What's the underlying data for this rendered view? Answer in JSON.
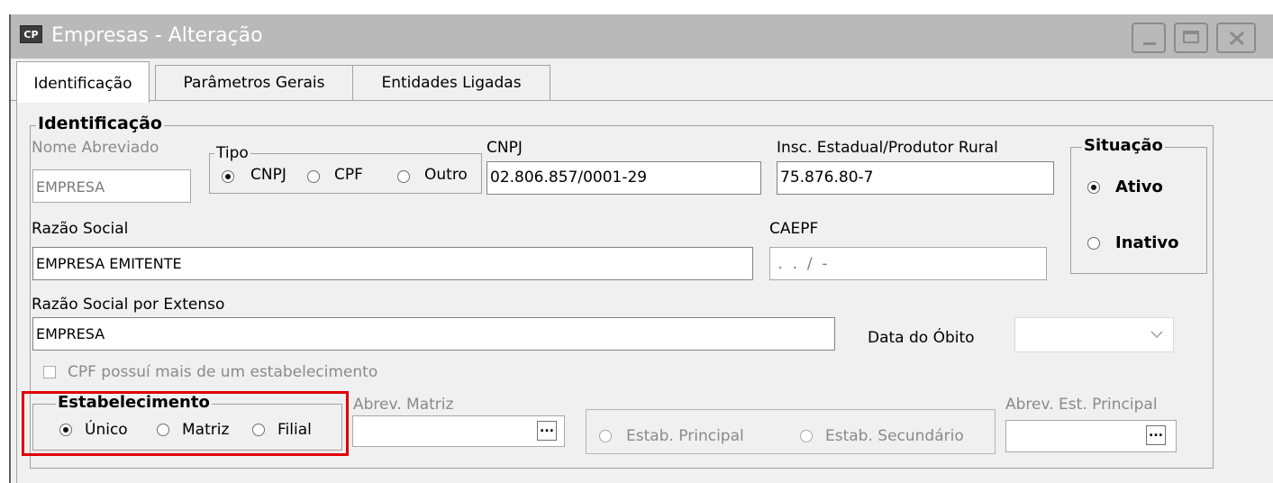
{
  "window": {
    "title": "Empresas - Alteração",
    "icon_label": "CP",
    "controls": [
      "minimize-icon",
      "maximize-icon",
      "close-icon"
    ]
  },
  "tabs": [
    {
      "label": "Identificação",
      "active": true
    },
    {
      "label": "Parâmetros Gerais",
      "active": false
    },
    {
      "label": "Entidades Ligadas",
      "active": false
    }
  ],
  "identificacao": {
    "group_label": "Identificação",
    "nome_abreviado": {
      "label": "Nome Abreviado",
      "value": "EMPRESA"
    },
    "tipo": {
      "label": "Tipo",
      "options": [
        "CNPJ",
        "CPF",
        "Outro"
      ],
      "selected": "CNPJ"
    },
    "cnpj": {
      "label": "CNPJ",
      "value": "02.806.857/0001-29"
    },
    "insc_estadual": {
      "label": "Insc. Estadual/Produtor Rural",
      "value": "75.876.80-7"
    },
    "situacao": {
      "label": "Situação",
      "options": [
        "Ativo",
        "Inativo"
      ],
      "selected": "Ativo"
    },
    "razao_social": {
      "label": "Razão Social",
      "value": "EMPRESA EMITENTE"
    },
    "caepf": {
      "label": "CAEPF",
      "value": " .  .  /  -"
    },
    "razao_social_extenso": {
      "label": "Razão Social por Extenso",
      "value": "EMPRESA"
    },
    "data_obito": {
      "label": "Data do Óbito",
      "value": ""
    },
    "cpf_mais_estab": {
      "label": "CPF possuí mais de um estabelecimento",
      "checked": false
    },
    "estabelecimento": {
      "label": "Estabelecimento",
      "options": [
        "Único",
        "Matriz",
        "Filial"
      ],
      "selected": "Único"
    },
    "abrev_matriz": {
      "label": "Abrev. Matriz",
      "value": "",
      "button": "..."
    },
    "estab_tipo": {
      "options": [
        "Estab. Principal",
        "Estab. Secundário"
      ]
    },
    "abrev_est_principal": {
      "label": "Abrev. Est. Principal",
      "value": "",
      "button": "..."
    }
  },
  "colors": {
    "titlebar": "#b9b9b9",
    "panel": "#f0f0f0",
    "highlight": "#e00000"
  }
}
